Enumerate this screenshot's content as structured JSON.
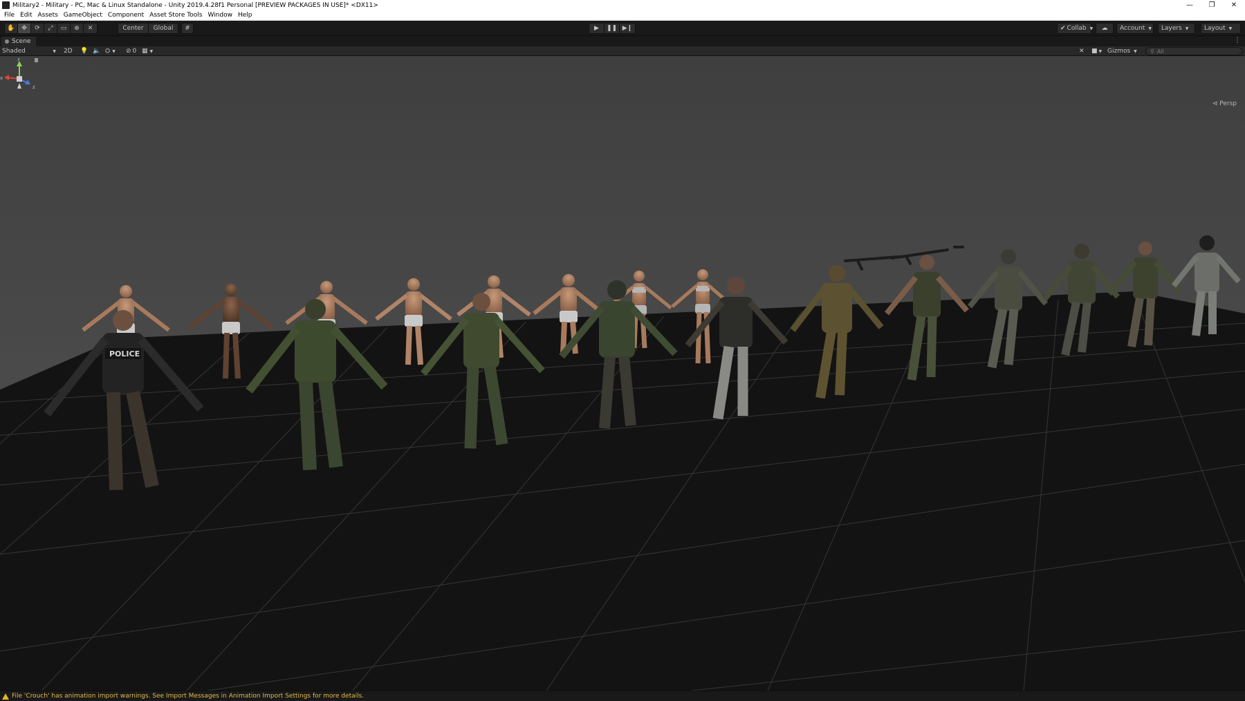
{
  "window": {
    "title": "Military2 - Military - PC, Mac & Linux Standalone - Unity 2019.4.28f1 Personal [PREVIEW PACKAGES IN USE]* <DX11>",
    "minimize_glyph": "—",
    "maximize_glyph": "❐",
    "close_glyph": "✕"
  },
  "menubar": {
    "items": [
      "File",
      "Edit",
      "Assets",
      "GameObject",
      "Component",
      "Asset Store Tools",
      "Window",
      "Help"
    ]
  },
  "toolbar": {
    "tools": [
      {
        "name": "hand-tool-icon",
        "glyph": "✋"
      },
      {
        "name": "move-tool-icon",
        "glyph": "✥"
      },
      {
        "name": "rotate-tool-icon",
        "glyph": "⟳"
      },
      {
        "name": "scale-tool-icon",
        "glyph": "⤢"
      },
      {
        "name": "rect-tool-icon",
        "glyph": "▭"
      },
      {
        "name": "transform-tool-icon",
        "glyph": "⊕"
      },
      {
        "name": "custom-tool-icon",
        "glyph": "✕"
      }
    ],
    "pivot_label": "Center",
    "space_label": "Global",
    "play_glyph": "▶",
    "pause_glyph": "❚❚",
    "step_glyph": "▶❙",
    "collab_label": "Collab",
    "account_label": "Account",
    "layers_label": "Layers",
    "layout_label": "Layout"
  },
  "scene_tab": {
    "label": "Scene"
  },
  "scene_toolbar": {
    "shading_mode": "Shaded",
    "mode_2d": "2D",
    "hidden_count": "0",
    "gizmos_label": "Gizmos",
    "search_placeholder": "All"
  },
  "gizmo": {
    "y_label": "y",
    "x_label": "x",
    "z_label": "z",
    "projection_label": "Persp"
  },
  "status": {
    "message": "File 'Crouch' has animation import warnings. See Import Messages in Animation Import Settings for more details."
  },
  "colors": {
    "viewport_sky": "#4a4a4a",
    "floor": "#121212",
    "grid": "#3a3a3a",
    "status_warning": "#e1b94a"
  }
}
